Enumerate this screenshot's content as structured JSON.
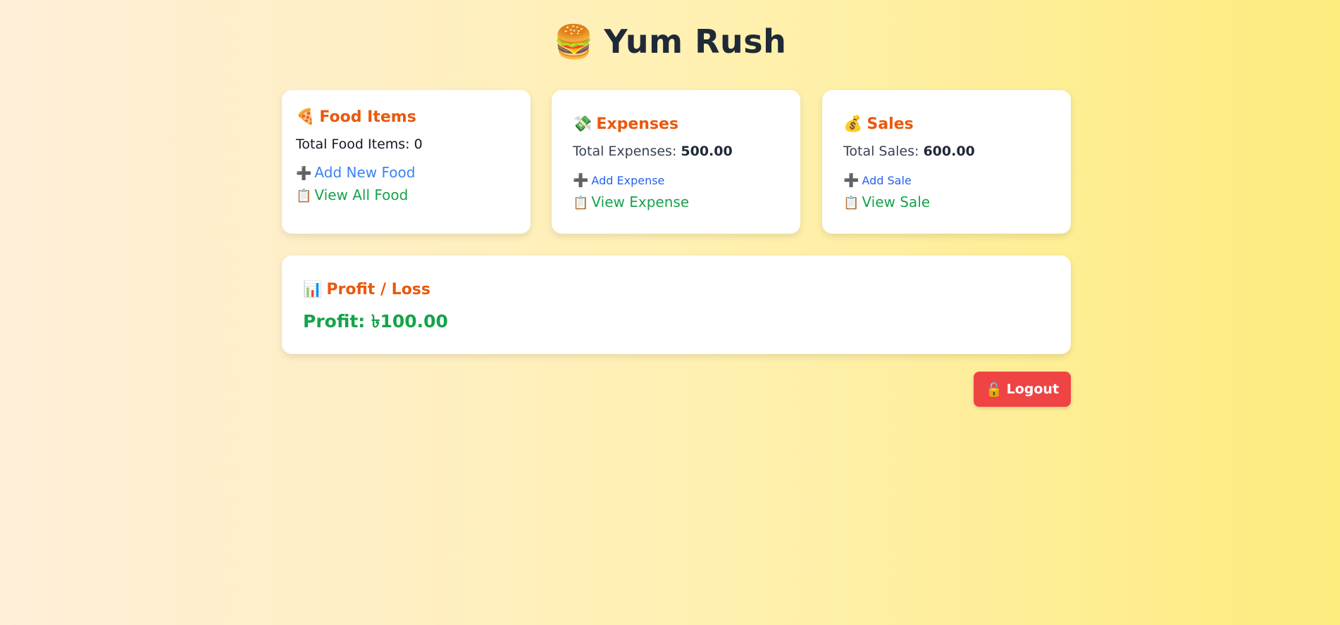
{
  "app": {
    "title": "Yum Rush",
    "title_icon": "🍔"
  },
  "food": {
    "icon": "🍕",
    "title": "Food Items",
    "total_label": "Total Food Items: ",
    "total_value": "0",
    "add_icon": "➕",
    "add_label": "Add New Food",
    "view_icon": "📋",
    "view_label": "View All Food"
  },
  "expenses": {
    "icon": "💸",
    "title": "Expenses",
    "total_label": "Total Expenses: ",
    "total_value": "500.00",
    "add_icon": "➕",
    "add_label": "Add Expense",
    "view_icon": "📋",
    "view_label": "View Expense"
  },
  "sales": {
    "icon": "💰",
    "title": "Sales",
    "total_label": "Total Sales: ",
    "total_value": "600.00",
    "add_icon": "➕",
    "add_label": "Add Sale",
    "view_icon": "📋",
    "view_label": "View Sale"
  },
  "profit": {
    "icon": "📊",
    "title": "Profit / Loss",
    "value_text": "Profit: ৳100.00"
  },
  "logout": {
    "icon": "🔓",
    "label": "Logout"
  },
  "colors": {
    "accent_orange": "#ea580c",
    "link_blue": "#3b82f6",
    "link_green": "#16a34a",
    "logout_red": "#ef4444"
  }
}
